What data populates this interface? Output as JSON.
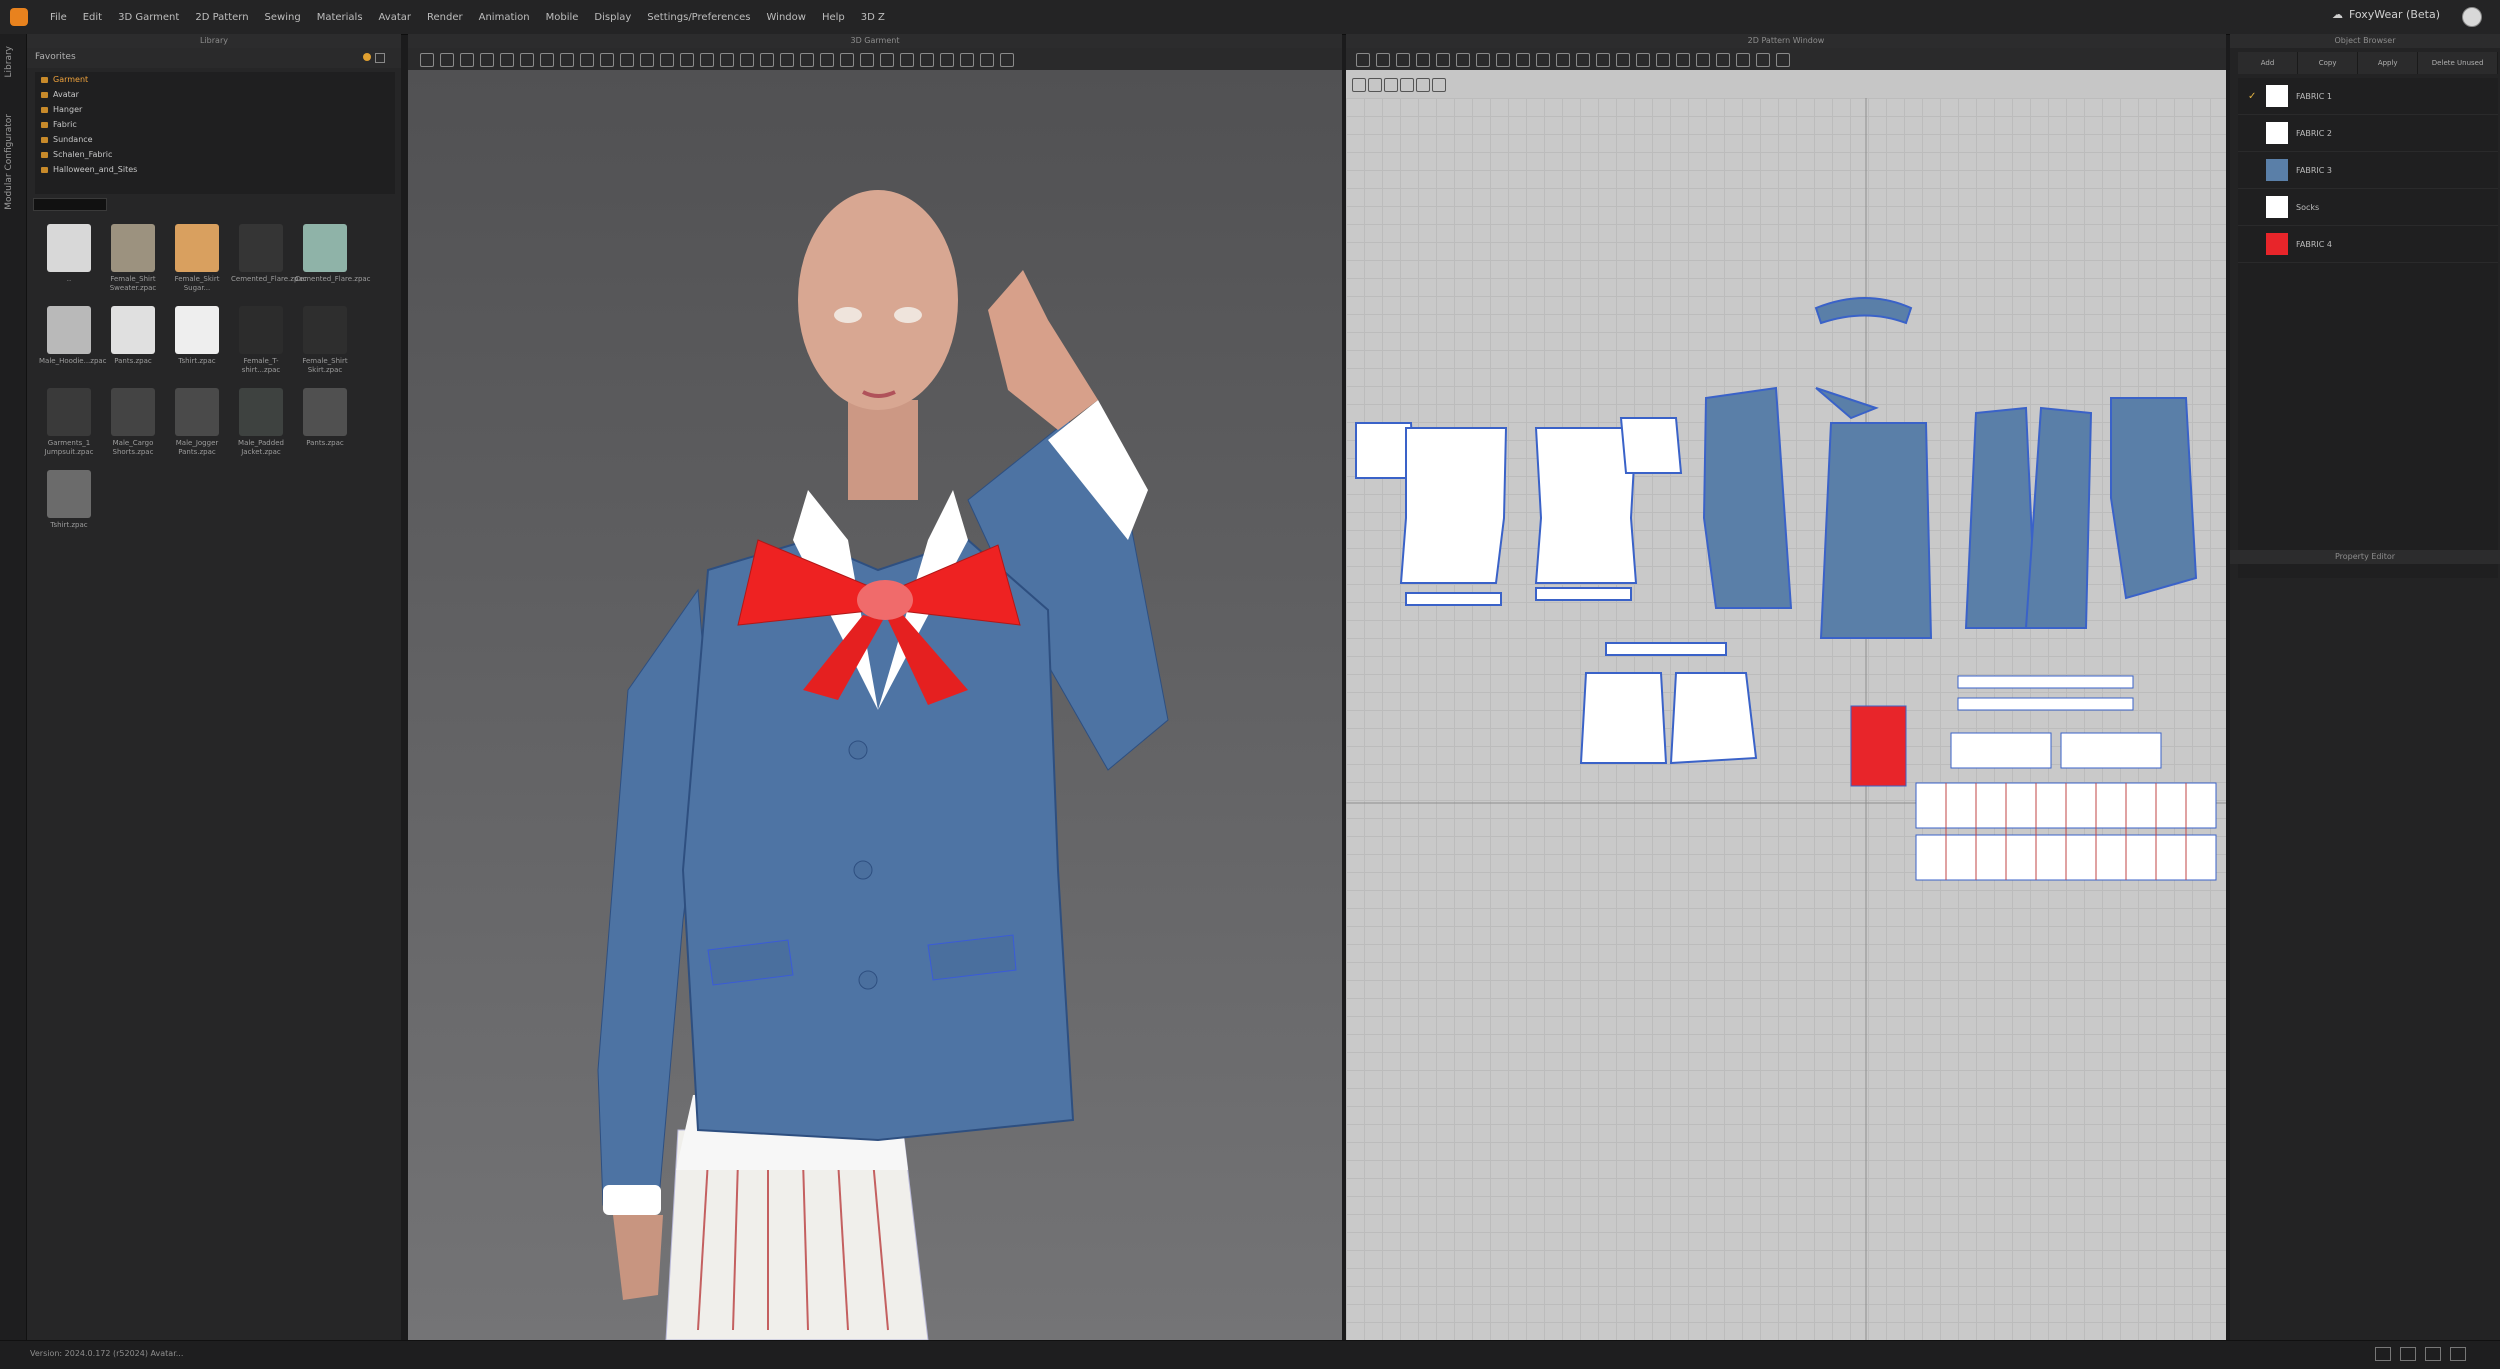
{
  "menubar": {
    "items": [
      "File",
      "Edit",
      "3D Garment",
      "2D Pattern",
      "Sewing",
      "Materials",
      "Avatar",
      "Render",
      "Animation",
      "Mobile",
      "Display",
      "Settings/Preferences",
      "Window",
      "Help",
      "3D Z"
    ],
    "user": "FoxyWear (Beta)"
  },
  "left_strip": {
    "tabs": [
      "Library",
      "Modular Configurator"
    ]
  },
  "library": {
    "title": "Library",
    "favorites_label": "Favorites",
    "folders": [
      {
        "label": "Garment",
        "selected": true
      },
      {
        "label": "Avatar",
        "selected": false
      },
      {
        "label": "Hanger",
        "selected": false
      },
      {
        "label": "Fabric",
        "selected": false
      },
      {
        "label": "Sundance",
        "selected": false
      },
      {
        "label": "Schalen_Fabric",
        "selected": false
      },
      {
        "label": "Halloween_and_Sites",
        "selected": false
      }
    ],
    "assets": [
      {
        "label": "..",
        "color": "#d8d8d8"
      },
      {
        "label": "Female_Shirt Sweater.zpac",
        "color": "#9c927f"
      },
      {
        "label": "Female_Skirt Sugar...",
        "color": "#d9a05f"
      },
      {
        "label": "Cemented_Flare.zpac",
        "color": "#353535"
      },
      {
        "label": "Cemented_Flare.zpac",
        "color": "#8fb3a8"
      },
      {
        "label": "Male_Hoodie...zpac",
        "color": "#b9b9b9"
      },
      {
        "label": "Pants.zpac",
        "color": "#e0e0e0"
      },
      {
        "label": "Tshirt.zpac",
        "color": "#eeeeee"
      },
      {
        "label": "Female_T-shirt...zpac",
        "color": "#2c2c2c"
      },
      {
        "label": "Female_Shirt Skirt.zpac",
        "color": "#2e2e2e"
      },
      {
        "label": "Garments_1 Jumpsuit.zpac",
        "color": "#3a3a3a"
      },
      {
        "label": "Male_Cargo Shorts.zpac",
        "color": "#444444"
      },
      {
        "label": "Male_Jogger Pants.zpac",
        "color": "#4a4a4a"
      },
      {
        "label": "Male_Padded Jacket.zpac",
        "color": "#3e4240"
      },
      {
        "label": "Pants.zpac",
        "color": "#505050"
      },
      {
        "label": "Tshirt.zpac",
        "color": "#6b6b6b"
      }
    ]
  },
  "window3d": {
    "title": "3D Garment"
  },
  "window2d": {
    "title": "2D Pattern Window"
  },
  "objects": {
    "title": "Object Browser",
    "buttons": [
      "Add",
      "Copy",
      "Apply",
      "Delete Unused"
    ],
    "fabrics": [
      {
        "label": "FABRIC 1",
        "color": "#ffffff",
        "checked": true
      },
      {
        "label": "FABRIC 2",
        "color": "#ffffff",
        "checked": false
      },
      {
        "label": "FABRIC 3",
        "color": "#5a7fa8",
        "checked": false
      },
      {
        "label": "Socks",
        "color": "#ffffff",
        "checked": false
      },
      {
        "label": "FABRIC 4",
        "color": "#e8252a",
        "checked": false
      }
    ],
    "property_editor": "Property Editor"
  },
  "status": {
    "text": "Version: 2024.0.172 (r52024) Avatar..."
  }
}
